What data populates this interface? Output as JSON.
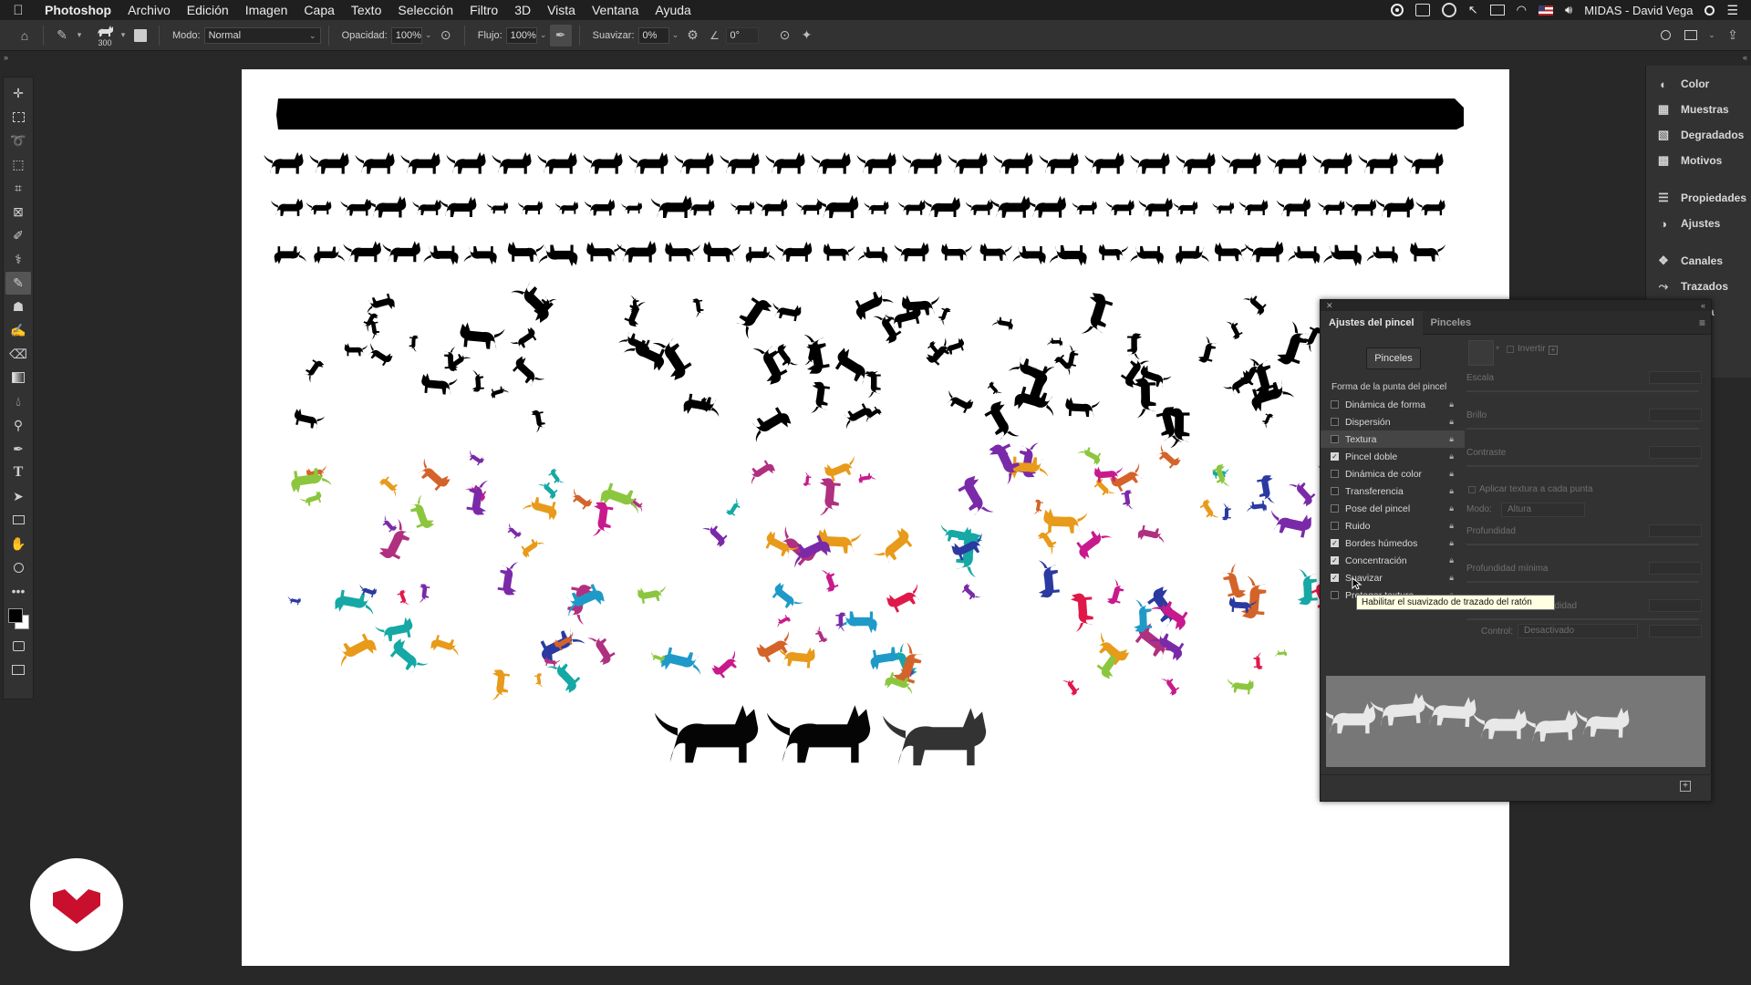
{
  "menubar": {
    "app": "Photoshop",
    "items": [
      "Archivo",
      "Edición",
      "Imagen",
      "Capa",
      "Texto",
      "Selección",
      "Filtro",
      "3D",
      "Vista",
      "Ventana",
      "Ayuda"
    ],
    "user": "MIDAS - David Vega"
  },
  "options": {
    "brush_size": "300",
    "mode_label": "Modo:",
    "mode_value": "Normal",
    "opacity_label": "Opacidad:",
    "opacity_value": "100%",
    "flow_label": "Flujo:",
    "flow_value": "100%",
    "smooth_label": "Suavizar:",
    "smooth_value": "0%",
    "angle_value": "0°"
  },
  "dock": {
    "items": [
      "Color",
      "Muestras",
      "Degradados",
      "Motivos",
      "Propiedades",
      "Ajustes",
      "Canales",
      "Trazados"
    ],
    "icons": [
      "color-wheel-icon",
      "swatches-grid-icon",
      "gradient-icon",
      "patterns-icon",
      "properties-icon",
      "adjustments-icon",
      "channels-icon",
      "paths-icon"
    ],
    "partial_item": "a"
  },
  "brush_panel": {
    "tabs": [
      "Ajustes del pincel",
      "Pinceles"
    ],
    "brushes_button": "Pinceles",
    "section_head": "Forma de la punta del pincel",
    "rows": [
      {
        "label": "Dinámica de forma",
        "checked": false
      },
      {
        "label": "Dispersión",
        "checked": false
      },
      {
        "label": "Textura",
        "checked": false
      },
      {
        "label": "Pincel doble",
        "checked": true
      },
      {
        "label": "Dinámica de color",
        "checked": false
      },
      {
        "label": "Transferencia",
        "checked": false
      },
      {
        "label": "Pose del pincel",
        "checked": false
      },
      {
        "label": "Ruido",
        "checked": false
      },
      {
        "label": "Bordes húmedos",
        "checked": true
      },
      {
        "label": "Concentración",
        "checked": true
      },
      {
        "label": "Suavizar",
        "checked": true
      },
      {
        "label": "Proteger textura",
        "checked": false
      }
    ],
    "texture": {
      "invert": "Invertir",
      "scale": "Escala",
      "brightness": "Brillo",
      "contrast": "Contraste",
      "apply_each": "Aplicar textura a cada punta",
      "mode_label": "Modo:",
      "mode_value": "Altura",
      "depth": "Profundidad",
      "min_depth": "Profundidad mínima",
      "depth_jitter": "Variación de la profundidad",
      "control_label": "Control:",
      "control_value": "Desactivado"
    },
    "tooltip": "Habilitar el suavizado de trazado del ratón"
  },
  "canvas_colors": {
    "black": "#000000",
    "palette": [
      "#16a8a4",
      "#d4632a",
      "#7a2aa8",
      "#e0184a",
      "#c81a8c",
      "#2a3aa0",
      "#8cc63f",
      "#e89a1a",
      "#1f9ac8",
      "#b03080"
    ]
  },
  "colors": {
    "ui_bg": "#282828",
    "panel": "#323232",
    "tooltip_bg": "#ffffe1",
    "logo_red": "#c8102e"
  }
}
